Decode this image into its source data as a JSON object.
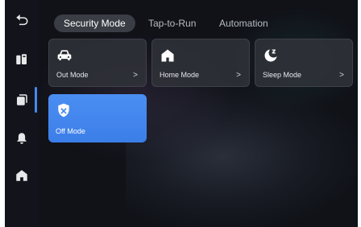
{
  "tabs": [
    {
      "label": "Security Mode"
    },
    {
      "label": "Tap-to-Run"
    },
    {
      "label": "Automation"
    }
  ],
  "sidebar": {
    "items": [
      {
        "icon": "back-arrow-icon"
      },
      {
        "icon": "devices-icon"
      },
      {
        "icon": "scenes-icon",
        "active": true
      },
      {
        "icon": "bell-icon"
      },
      {
        "icon": "home-icon"
      }
    ]
  },
  "modes": [
    {
      "label": "Out Mode",
      "icon": "car-icon",
      "chevron": ">"
    },
    {
      "label": "Home Mode",
      "icon": "house-icon",
      "chevron": ">"
    },
    {
      "label": "Sleep Mode",
      "icon": "moon-icon",
      "chevron": ">"
    },
    {
      "label": "Off Mode",
      "icon": "shield-off-icon",
      "active": true
    }
  ],
  "colors": {
    "accent": "#4a86f0",
    "background": "#101218",
    "card": "#30333a"
  }
}
